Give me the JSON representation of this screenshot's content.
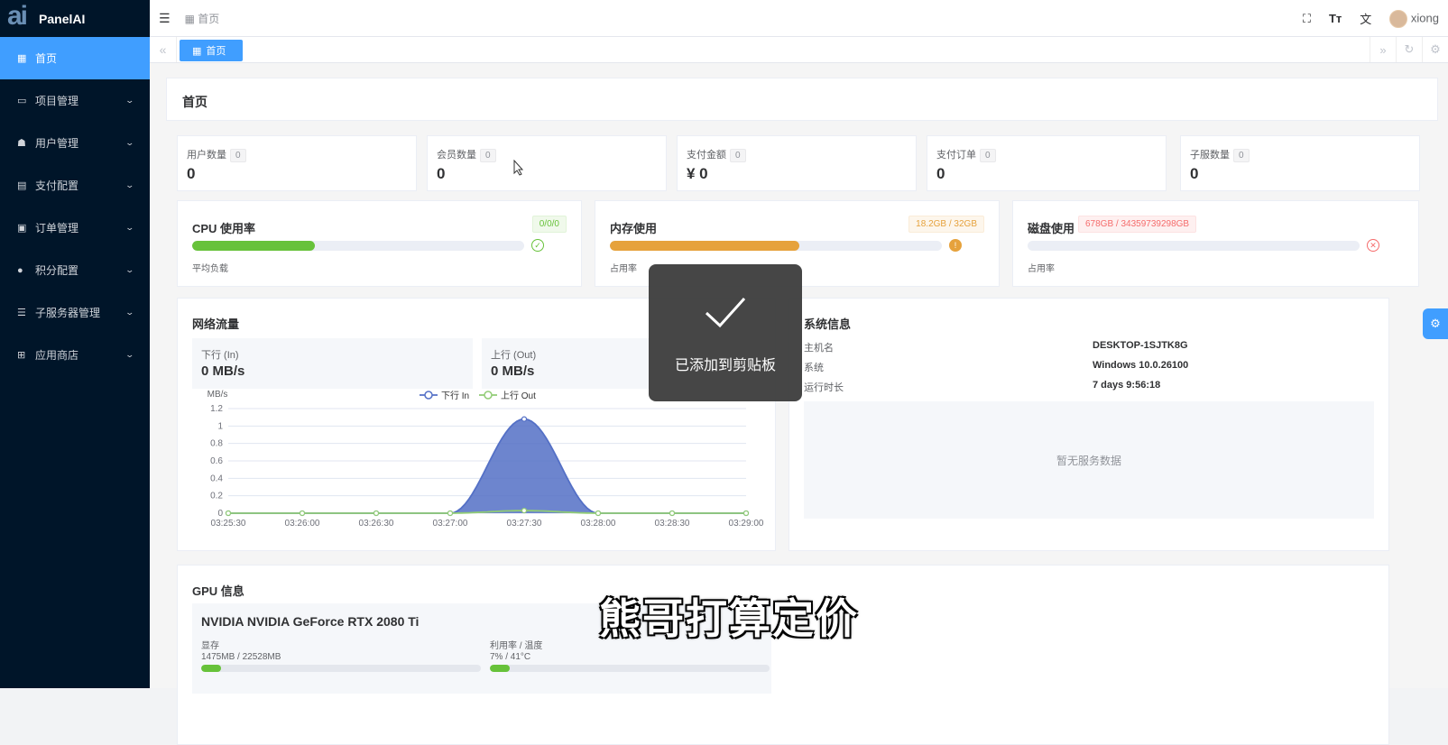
{
  "app": {
    "brand": "PanelAI",
    "logo_text": "ai"
  },
  "sidebar": {
    "items": [
      {
        "label": "首页",
        "icon": "grid-icon",
        "active": true
      },
      {
        "label": "项目管理",
        "icon": "folder-icon"
      },
      {
        "label": "用户管理",
        "icon": "users-icon"
      },
      {
        "label": "支付配置",
        "icon": "card-icon"
      },
      {
        "label": "订单管理",
        "icon": "clipboard-icon"
      },
      {
        "label": "积分配置",
        "icon": "coin-icon"
      },
      {
        "label": "子服务器管理",
        "icon": "server-icon"
      },
      {
        "label": "应用商店",
        "icon": "apps-icon"
      }
    ]
  },
  "header": {
    "breadcrumb": "首页",
    "username": "xiong"
  },
  "tabs": [
    {
      "label": "首页"
    }
  ],
  "page": {
    "title": "首页"
  },
  "stats": [
    {
      "label": "用户数量",
      "badge": "0",
      "value": "0"
    },
    {
      "label": "会员数量",
      "badge": "0",
      "value": "0"
    },
    {
      "label": "支付金额",
      "badge": "0",
      "value": "¥ 0"
    },
    {
      "label": "支付订单",
      "badge": "0",
      "value": "0"
    },
    {
      "label": "子服数量",
      "badge": "0",
      "value": "0"
    }
  ],
  "resources": {
    "cpu": {
      "title": "CPU 使用率",
      "badge": "0/0/0",
      "sub": "平均负载",
      "percent": 37,
      "color": "#67c23a"
    },
    "mem": {
      "title": "内存使用",
      "badge": "18.2GB / 32GB",
      "sub": "占用率",
      "percent": 57,
      "color": "#e6a23c"
    },
    "disk": {
      "title": "磁盘使用",
      "badge": "678GB / 34359739298GB",
      "sub": "占用率",
      "percent": 0,
      "color": "#f56c6c"
    }
  },
  "network": {
    "title": "网络流量",
    "in_label": "下行 (In)",
    "in_value": "0 MB/s",
    "out_label": "上行 (Out)",
    "out_value": "0 MB/s"
  },
  "chart_data": {
    "type": "area",
    "ylabel": "MB/s",
    "ylim": [
      0,
      1.2
    ],
    "yticks": [
      "1.2",
      "1",
      "0.8",
      "0.6",
      "0.4",
      "0.2",
      "0"
    ],
    "x": [
      "03:25:30",
      "03:26:00",
      "03:26:30",
      "03:27:00",
      "03:27:30",
      "03:28:00",
      "03:28:30",
      "03:29:00"
    ],
    "series": [
      {
        "name": "下行 In",
        "values": [
          0,
          0,
          0,
          0,
          1.08,
          0,
          0,
          0
        ],
        "color": "#5470c6"
      },
      {
        "name": "上行 Out",
        "values": [
          0,
          0,
          0,
          0,
          0.03,
          0,
          0,
          0
        ],
        "color": "#91cc75"
      }
    ]
  },
  "system": {
    "title": "系统信息",
    "rows": [
      {
        "key": "主机名",
        "value": "DESKTOP-1SJTK8G"
      },
      {
        "key": "系统",
        "value": "Windows 10.0.26100"
      },
      {
        "key": "运行时长",
        "value": "7 days 9:56:18"
      }
    ],
    "empty_text": "暂无服务数据"
  },
  "gpu": {
    "title": "GPU 信息",
    "name": "NVIDIA NVIDIA GeForce RTX 2080 Ti",
    "mem_label": "显存",
    "mem_value": "1475MB / 22528MB",
    "mem_percent": 7,
    "util_label": "利用率 / 温度",
    "util_value": "7% / 41°C",
    "util_percent": 7
  },
  "toast": {
    "message": "已添加到剪贴板"
  },
  "overlay_subtitle": "熊哥打算定价"
}
